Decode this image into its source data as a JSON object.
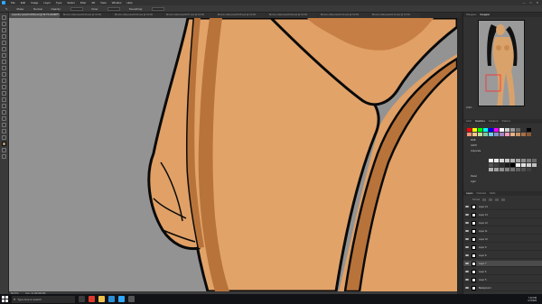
{
  "menubar": {
    "items": [
      "File",
      "Edit",
      "Image",
      "Layer",
      "Type",
      "Select",
      "Filter",
      "3D",
      "View",
      "Window",
      "Help"
    ],
    "window_controls": [
      "—",
      "□",
      "✕"
    ]
  },
  "optionsbar": {
    "items": [
      "Mode:",
      "Normal",
      "Opacity:",
      "Flow:",
      "Smoothing:"
    ]
  },
  "tabs": [
    {
      "label": "Lavender-pose03-1000.psd @ 66.7% (RGB/8*)",
      "active": true
    },
    {
      "label": "Bronze-nikki-pose03-05.psd @ 33.3%",
      "active": false
    },
    {
      "label": "Bronze-nikki-pose03-06.psd @ 33.3%",
      "active": false
    },
    {
      "label": "Bronze-nikki-pose03-07.psd @ 33.3%",
      "active": false
    },
    {
      "label": "Bronze-nikki-pose03-08.psd @ 33.3%",
      "active": false
    },
    {
      "label": "Bronze-nikki-pose03-09.psd @ 33.3%",
      "active": false
    },
    {
      "label": "Bronze-nikki-pose03-10.psd @ 33.3%",
      "active": false
    },
    {
      "label": "Bronze-nikki-pose03-11.psd @ 33.3%",
      "active": false
    }
  ],
  "statusbar": {
    "zoom": "66.67%",
    "doc_info": "Doc: 21.1M/366.9M"
  },
  "navigator": {
    "tabs": [
      "Histogram",
      "Navigator"
    ],
    "zoom": "100%"
  },
  "swatches": {
    "tabs": [
      "Color",
      "Swatches",
      "Gradients",
      "Patterns"
    ],
    "folders": [
      "RGB",
      "CMYK",
      "Grayscale",
      "Pastel",
      "Light"
    ],
    "colors": [
      "#ff0000",
      "#ffff00",
      "#00ff00",
      "#00ffff",
      "#0000ff",
      "#ff00ff",
      "#ffffff",
      "#cccccc",
      "#999999",
      "#666666",
      "#333333",
      "#000000",
      "#f7977a",
      "#fdc68a",
      "#c4df9b",
      "#82ca9c",
      "#6ecff6",
      "#8493ca",
      "#a187be",
      "#f49ac1",
      "#e6b389",
      "#c6956b",
      "#a86f46",
      "#8a5a35"
    ],
    "grays": [
      "#ffffff",
      "#ececec",
      "#d9d9d9",
      "#c6c6c6",
      "#b3b3b3",
      "#a0a0a0",
      "#8d8d8d",
      "#7a7a7a",
      "#676767",
      "#545454",
      "#414141",
      "#2e2e2e",
      "#1b1b1b",
      "#000000",
      "#f0f0f0",
      "#e0e0e0",
      "#d0d0d0",
      "#c0c0c0",
      "#b0b0b0",
      "#a0a0a0",
      "#909090",
      "#808080",
      "#707070",
      "#606060",
      "#505050",
      "#404040",
      "#303030"
    ]
  },
  "layers": {
    "tabs": [
      "Layers",
      "Channels",
      "Paths"
    ],
    "blend_mode": "Normal",
    "items": [
      {
        "name": "Layer 14",
        "selected": false
      },
      {
        "name": "Layer 13",
        "selected": false
      },
      {
        "name": "Layer 12",
        "selected": false
      },
      {
        "name": "Layer 11",
        "selected": false
      },
      {
        "name": "Layer 10",
        "selected": false
      },
      {
        "name": "Layer 9",
        "selected": false
      },
      {
        "name": "Layer 8",
        "selected": false
      },
      {
        "name": "Layer 7",
        "selected": true
      },
      {
        "name": "Layer 6",
        "selected": false
      },
      {
        "name": "Layer 5",
        "selected": false
      },
      {
        "name": "Background",
        "selected": false
      }
    ]
  },
  "taskbar": {
    "search_placeholder": "Type here to search",
    "time": "7:10 PM",
    "date": "1/7/2022"
  },
  "colors": {
    "skin": "#e0a066",
    "skin_shade": "#b8733a",
    "outline": "#0a0a0a",
    "canvas_bg": "#939393",
    "hair_shadow": "#c77f45"
  }
}
